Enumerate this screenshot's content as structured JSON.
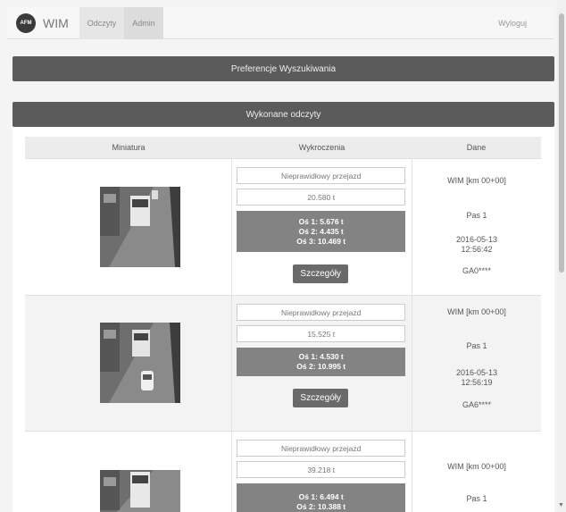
{
  "navbar": {
    "logo": "AFM",
    "brand": "WIM",
    "tabs": [
      "Odczyty",
      "Admin"
    ],
    "logout": "Wyloguj"
  },
  "search_panel": {
    "title": "Preferencje Wyszukiwania"
  },
  "results_panel": {
    "title": "Wykonane odczyty",
    "columns": [
      "Miniatura",
      "Wykroczenia",
      "Dane"
    ]
  },
  "rows": [
    {
      "violation": "Nieprawidłowy przejazd",
      "weight": "20.580 t",
      "axles": [
        "Oś 1: 5.676 t",
        "Oś 2: 4.435 t",
        "Oś 3: 10.469 t"
      ],
      "details_label": "Szczegóły",
      "station": "WIM [km 00+00]",
      "lane": "Pas 1",
      "date": "2016-05-13",
      "time": "12:56:42",
      "plate": "GA0****"
    },
    {
      "violation": "Nieprawidłowy przejazd",
      "weight": "15.525 t",
      "axles": [
        "Oś 1: 4.530 t",
        "Oś 2: 10.995 t"
      ],
      "details_label": "Szczegóły",
      "station": "WIM [km 00+00]",
      "lane": "Pas 1",
      "date": "2016-05-13",
      "time": "12:56:19",
      "plate": "GA6****"
    },
    {
      "violation": "Nieprawidłowy przejazd",
      "weight": "39.218 t",
      "axles": [
        "Oś 1: 6.494 t",
        "Oś 2: 10.388 t"
      ],
      "station": "WIM [km 00+00]",
      "lane": "Pas 1"
    }
  ]
}
